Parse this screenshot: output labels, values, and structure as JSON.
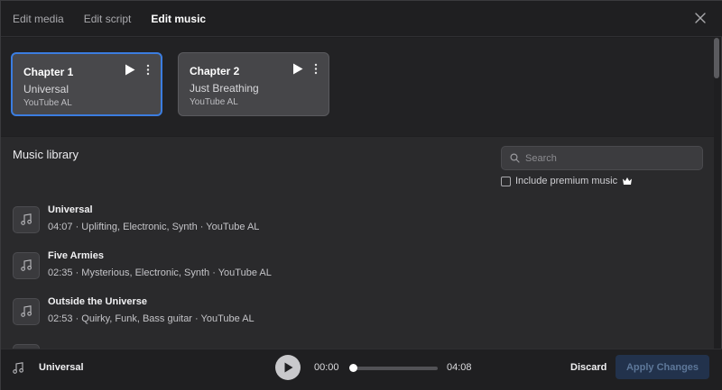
{
  "tabs": [
    {
      "label": "Edit media",
      "active": false
    },
    {
      "label": "Edit script",
      "active": false
    },
    {
      "label": "Edit music",
      "active": true
    }
  ],
  "chapters": [
    {
      "title": "Chapter 1",
      "song": "Universal",
      "source": "YouTube AL",
      "selected": true
    },
    {
      "title": "Chapter 2",
      "song": "Just Breathing",
      "source": "YouTube AL",
      "selected": false
    }
  ],
  "library": {
    "title": "Music library",
    "search_placeholder": "Search",
    "premium_label": "Include premium music",
    "premium_checked": false,
    "tracks": [
      {
        "name": "Universal",
        "meta": "04:07 · Uplifting, Electronic, Synth · YouTube AL"
      },
      {
        "name": "Five Armies",
        "meta": "02:35 · Mysterious, Electronic, Synth · YouTube AL"
      },
      {
        "name": "Outside the Universe",
        "meta": "02:53 · Quirky, Funk, Bass guitar · YouTube AL"
      }
    ]
  },
  "player": {
    "title": "Universal",
    "current_time": "00:00",
    "total_time": "04:08",
    "progress": 0,
    "discard_label": "Discard",
    "apply_label": "Apply Changes"
  },
  "colors": {
    "accent": "#3b7de0",
    "background": "#1f1f21",
    "library_bg": "#2a2a2c",
    "apply_bg": "#22324c"
  }
}
